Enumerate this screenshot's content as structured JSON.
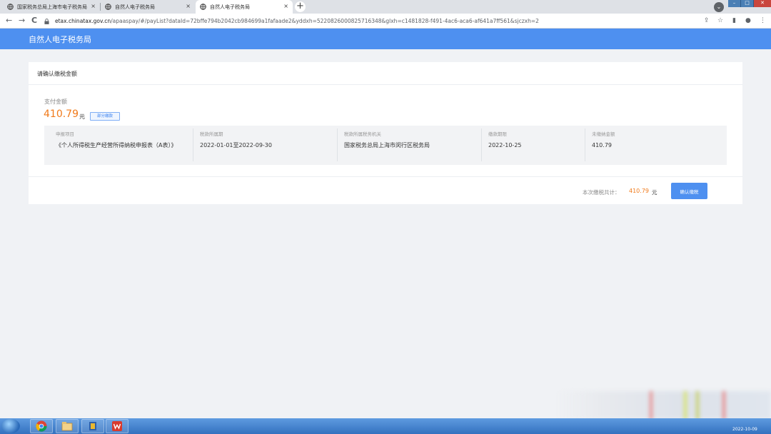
{
  "browser": {
    "tabs": [
      {
        "title": "国家税务总局上海市电子税务局",
        "active": false
      },
      {
        "title": "自然人电子税务局",
        "active": false
      },
      {
        "title": "自然人电子税务局",
        "active": true
      }
    ],
    "new_tab_label": "+",
    "url_domain": "etax.chinatax.gov.cn",
    "url_path": "/apaaspay/#/payList?dataId=72bffe794b2042cb984699a1fafaade2&yddxh=5220826000825716348&glxh=c1481828-f491-4ac6-aca6-af641a7ff561&sjczxh=2",
    "close_glyph": "×",
    "back_glyph": "←",
    "forward_glyph": "→",
    "reload_glyph": "C",
    "menu_glyph": "⋮"
  },
  "app": {
    "title": "自然人电子税务局"
  },
  "card": {
    "title": "请确认缴税金额",
    "pay_label": "支付金额",
    "pay_amount": "410.79",
    "pay_unit": "元",
    "partial_tag": "部分缴款",
    "table": {
      "columns": [
        {
          "header": "申报项目",
          "value": "《个人所得税生产经营所得纳税申报表（A表）》"
        },
        {
          "header": "税款所属期",
          "value": "2022-01-01至2022-09-30"
        },
        {
          "header": "税款所属税务机关",
          "value": "国家税务总局上海市闵行区税务局"
        },
        {
          "header": "缴款期限",
          "value": "2022-10-25"
        },
        {
          "header": "未缴纳金额",
          "value": "410.79"
        }
      ]
    },
    "total_label": "本次缴税共计：",
    "total_amount": "410.79",
    "total_unit": "元",
    "confirm_button": "确认缴税"
  },
  "taskbar": {
    "date": "2022-10-09",
    "items": [
      "chrome-icon",
      "file-explorer-icon",
      "app-icon",
      "wps-icon"
    ]
  },
  "colors": {
    "brand_blue": "#4e90f0",
    "amount_orange": "#f07a1a"
  }
}
